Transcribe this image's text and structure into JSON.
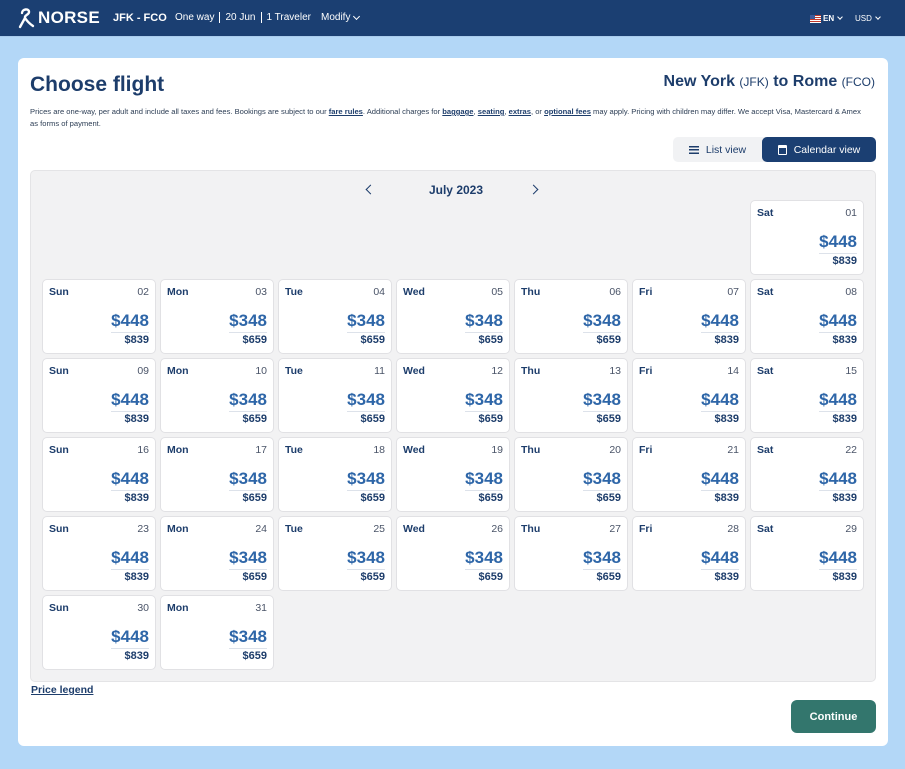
{
  "header": {
    "brand": "NORSE",
    "route": "JFK - FCO",
    "trip_type": "One way",
    "date": "20 Jun",
    "travelers": "1 Traveler",
    "modify_label": "Modify",
    "language": "EN",
    "currency": "USD"
  },
  "page": {
    "title": "Choose flight",
    "route_title": {
      "origin_city": "New York",
      "origin_code": "(JFK)",
      "connector": "to",
      "destination_city": "Rome",
      "destination_code": "(FCO)"
    },
    "disclaimer": {
      "part1": "Prices are one-way, per adult and include all taxes and fees. Bookings are subject to our ",
      "link_fare_rules": "fare rules",
      "part2": ". Additional charges for ",
      "link_baggage": "baggage",
      "comma1": ", ",
      "link_seating": "seating",
      "comma2": ", ",
      "link_extras": "extras",
      "part3": ", or ",
      "link_optional_fees": "optional fees",
      "part4": " may apply. Pricing with children may differ. We accept Visa, Mastercard & Amex as forms of payment."
    },
    "view_toggle": {
      "list_label": "List view",
      "calendar_label": "Calendar view",
      "active": "calendar"
    },
    "calendar": {
      "month_label": "July 2023",
      "leading_empty": 6,
      "days": [
        {
          "dow": "Sat",
          "day": "01",
          "price": "$448",
          "alt_price": "$839"
        },
        {
          "dow": "Sun",
          "day": "02",
          "price": "$448",
          "alt_price": "$839"
        },
        {
          "dow": "Mon",
          "day": "03",
          "price": "$348",
          "alt_price": "$659"
        },
        {
          "dow": "Tue",
          "day": "04",
          "price": "$348",
          "alt_price": "$659"
        },
        {
          "dow": "Wed",
          "day": "05",
          "price": "$348",
          "alt_price": "$659"
        },
        {
          "dow": "Thu",
          "day": "06",
          "price": "$348",
          "alt_price": "$659"
        },
        {
          "dow": "Fri",
          "day": "07",
          "price": "$448",
          "alt_price": "$839"
        },
        {
          "dow": "Sat",
          "day": "08",
          "price": "$448",
          "alt_price": "$839"
        },
        {
          "dow": "Sun",
          "day": "09",
          "price": "$448",
          "alt_price": "$839"
        },
        {
          "dow": "Mon",
          "day": "10",
          "price": "$348",
          "alt_price": "$659"
        },
        {
          "dow": "Tue",
          "day": "11",
          "price": "$348",
          "alt_price": "$659"
        },
        {
          "dow": "Wed",
          "day": "12",
          "price": "$348",
          "alt_price": "$659"
        },
        {
          "dow": "Thu",
          "day": "13",
          "price": "$348",
          "alt_price": "$659"
        },
        {
          "dow": "Fri",
          "day": "14",
          "price": "$448",
          "alt_price": "$839"
        },
        {
          "dow": "Sat",
          "day": "15",
          "price": "$448",
          "alt_price": "$839"
        },
        {
          "dow": "Sun",
          "day": "16",
          "price": "$448",
          "alt_price": "$839"
        },
        {
          "dow": "Mon",
          "day": "17",
          "price": "$348",
          "alt_price": "$659"
        },
        {
          "dow": "Tue",
          "day": "18",
          "price": "$348",
          "alt_price": "$659"
        },
        {
          "dow": "Wed",
          "day": "19",
          "price": "$348",
          "alt_price": "$659"
        },
        {
          "dow": "Thu",
          "day": "20",
          "price": "$348",
          "alt_price": "$659"
        },
        {
          "dow": "Fri",
          "day": "21",
          "price": "$448",
          "alt_price": "$839"
        },
        {
          "dow": "Sat",
          "day": "22",
          "price": "$448",
          "alt_price": "$839"
        },
        {
          "dow": "Sun",
          "day": "23",
          "price": "$448",
          "alt_price": "$839"
        },
        {
          "dow": "Mon",
          "day": "24",
          "price": "$348",
          "alt_price": "$659"
        },
        {
          "dow": "Tue",
          "day": "25",
          "price": "$348",
          "alt_price": "$659"
        },
        {
          "dow": "Wed",
          "day": "26",
          "price": "$348",
          "alt_price": "$659"
        },
        {
          "dow": "Thu",
          "day": "27",
          "price": "$348",
          "alt_price": "$659"
        },
        {
          "dow": "Fri",
          "day": "28",
          "price": "$448",
          "alt_price": "$839"
        },
        {
          "dow": "Sat",
          "day": "29",
          "price": "$448",
          "alt_price": "$839"
        },
        {
          "dow": "Sun",
          "day": "30",
          "price": "$448",
          "alt_price": "$839"
        },
        {
          "dow": "Mon",
          "day": "31",
          "price": "$348",
          "alt_price": "$659"
        }
      ]
    },
    "price_legend_label": "Price legend",
    "continue_label": "Continue"
  }
}
